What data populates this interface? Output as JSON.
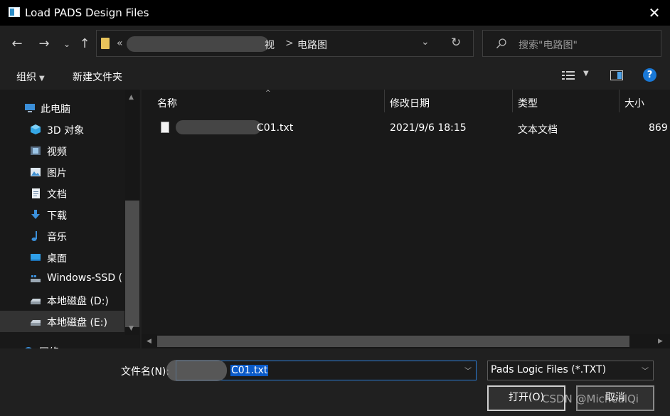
{
  "window": {
    "title": "Load PADS Design Files",
    "close_label": "✕"
  },
  "navigation": {
    "back": "←",
    "forward": "→",
    "recent": "⌄",
    "up": "↑",
    "address": {
      "chevron": "«",
      "partial_segment": "视",
      "separator": ">",
      "current_folder": "电路图",
      "dropdown": "⌄",
      "refresh": "↻"
    },
    "search_placeholder": "搜索\"电路图\""
  },
  "toolbar": {
    "organize": "组织",
    "new_folder": "新建文件夹"
  },
  "sidebar": {
    "items": [
      {
        "label": "此电脑",
        "icon": "computer-icon"
      },
      {
        "label": "3D 对象",
        "icon": "cube-3d-icon"
      },
      {
        "label": "视频",
        "icon": "video-icon"
      },
      {
        "label": "图片",
        "icon": "picture-icon"
      },
      {
        "label": "文档",
        "icon": "document-icon"
      },
      {
        "label": "下载",
        "icon": "download-icon"
      },
      {
        "label": "音乐",
        "icon": "music-icon"
      },
      {
        "label": "桌面",
        "icon": "desktop-icon"
      },
      {
        "label": "Windows-SSD (",
        "icon": "drive-icon"
      },
      {
        "label": "本地磁盘 (D:)",
        "icon": "disk-icon"
      },
      {
        "label": "本地磁盘 (E:)",
        "icon": "disk-icon"
      },
      {
        "label": "网络",
        "icon": "network-icon"
      }
    ],
    "selected_index": 10
  },
  "file_list": {
    "columns": [
      "名称",
      "修改日期",
      "类型",
      "大小"
    ],
    "rows": [
      {
        "name": "C01.txt",
        "modified": "2021/9/6 18:15",
        "type": "文本文档",
        "size": "869"
      }
    ]
  },
  "bottom": {
    "filename_label": "文件名(N):",
    "filename_value": "C01.txt",
    "filter_value": "Pads Logic Files (*.TXT)",
    "open_label": "打开(O)",
    "cancel_label": "取消",
    "watermark": "CSDN @MichealQi"
  },
  "colors": {
    "background": "#202020",
    "pane": "#191919",
    "accent": "#0a5ac8",
    "help": "#1978d6",
    "folder": "#e8c35b"
  }
}
